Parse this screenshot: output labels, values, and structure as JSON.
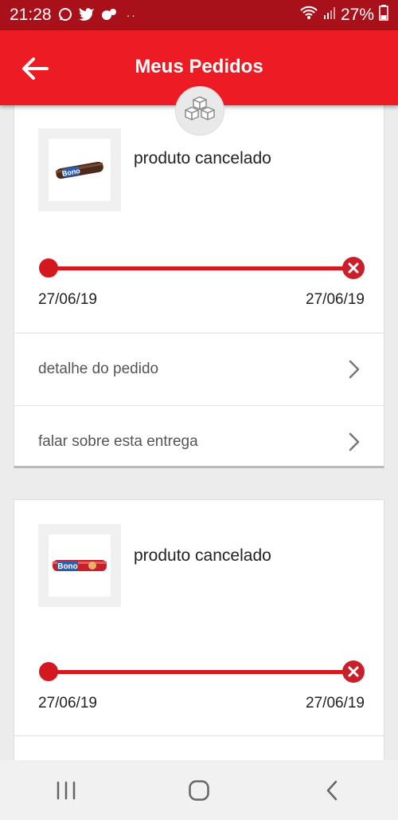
{
  "status_bar": {
    "time": "21:28",
    "battery": "27%",
    "notification_icons": [
      "whatsapp-icon",
      "twitter-icon",
      "app-icon"
    ],
    "more": "··"
  },
  "header": {
    "title": "Meus Pedidos",
    "back_icon": "arrow-left-icon",
    "badge_icon": "boxes-icon"
  },
  "orders": [
    {
      "status": "produto cancelado",
      "product_image": "bono-biscuit",
      "start_date": "27/06/19",
      "end_date": "27/06/19",
      "actions": [
        "detalhe do pedido",
        "falar sobre esta entrega"
      ]
    },
    {
      "status": "produto cancelado",
      "product_image": "bono-biscuit",
      "start_date": "27/06/19",
      "end_date": "27/06/19"
    }
  ],
  "colors": {
    "brand_red": "#ed1c24",
    "status_bar": "#a8101a",
    "track_red": "#d31820"
  },
  "nav_bar": [
    "recent-apps-icon",
    "home-icon",
    "back-icon"
  ]
}
